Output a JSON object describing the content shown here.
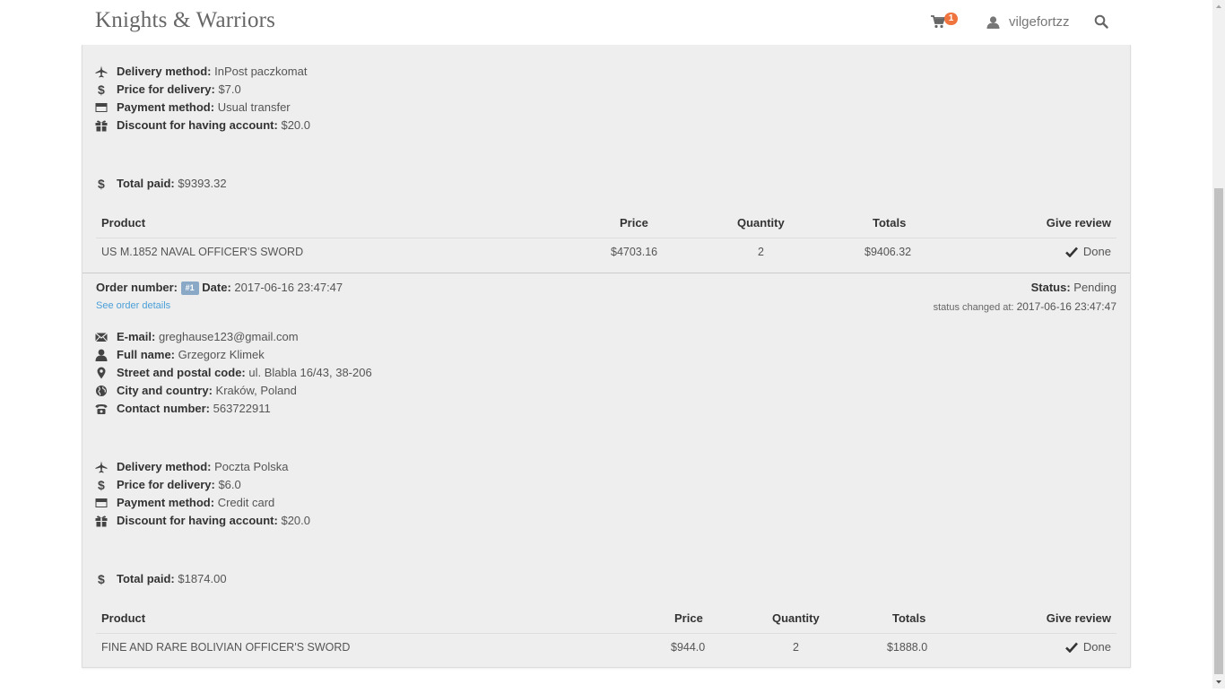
{
  "navbar": {
    "brand": "Knights & Warriors",
    "cart_count": "1",
    "username": "vilgefortzz"
  },
  "orders": [
    {
      "delivery": [
        {
          "icon": "plane-icon",
          "label": "Delivery method:",
          "value": "InPost paczkomat"
        },
        {
          "icon": "dollar-icon",
          "label": "Price for delivery:",
          "value": "$7.0"
        },
        {
          "icon": "credit-card-icon",
          "label": "Payment method:",
          "value": "Usual transfer"
        },
        {
          "icon": "gift-icon",
          "label": "Discount for having account:",
          "value": "$20.0"
        }
      ],
      "total": {
        "icon": "dollar-icon",
        "label": "Total paid:",
        "value": "$9393.32"
      },
      "table": {
        "headers": {
          "product": "Product",
          "price": "Price",
          "quantity": "Quantity",
          "totals": "Totals",
          "review": "Give review"
        },
        "rows": [
          {
            "product": "US M.1852 NAVAL OFFICER'S SWORD",
            "price": "$4703.16",
            "quantity": "2",
            "totals": "$9406.32",
            "review": "Done"
          }
        ]
      }
    },
    {
      "number_label": "Order number:",
      "number_badge": "#1",
      "date_label": "Date:",
      "date": "2017-06-16 23:47:47",
      "details_link": "See order details",
      "status_label": "Status:",
      "status": "Pending",
      "status_changed_label": "status changed at:",
      "status_changed": "2017-06-16 23:47:47",
      "customer": [
        {
          "icon": "envelope-icon",
          "label": "E-mail:",
          "value": "greghause123@gmail.com"
        },
        {
          "icon": "user-icon",
          "label": "Full name:",
          "value": "Grzegorz Klimek"
        },
        {
          "icon": "map-marker-icon",
          "label": "Street and postal code:",
          "value": "ul. Blabla 16/43, 38-206"
        },
        {
          "icon": "globe-icon",
          "label": "City and country:",
          "value": "Kraków, Poland"
        },
        {
          "icon": "phone-icon",
          "label": "Contact number:",
          "value": "563722911"
        }
      ],
      "delivery": [
        {
          "icon": "plane-icon",
          "label": "Delivery method:",
          "value": "Poczta Polska"
        },
        {
          "icon": "dollar-icon",
          "label": "Price for delivery:",
          "value": "$6.0"
        },
        {
          "icon": "credit-card-icon",
          "label": "Payment method:",
          "value": "Credit card"
        },
        {
          "icon": "gift-icon",
          "label": "Discount for having account:",
          "value": "$20.0"
        }
      ],
      "total": {
        "icon": "dollar-icon",
        "label": "Total paid:",
        "value": "$1874.00"
      },
      "table": {
        "headers": {
          "product": "Product",
          "price": "Price",
          "quantity": "Quantity",
          "totals": "Totals",
          "review": "Give review"
        },
        "rows": [
          {
            "product": "FINE AND RARE BOLIVIAN OFFICER'S SWORD",
            "price": "$944.0",
            "quantity": "2",
            "totals": "$1888.0",
            "review": "Done"
          }
        ]
      }
    }
  ],
  "colors": {
    "accent_link": "#4a9fd8",
    "cart_badge": "#f0743e",
    "order_badge": "#8aa9c7",
    "panel_bg": "#eeeeee"
  }
}
